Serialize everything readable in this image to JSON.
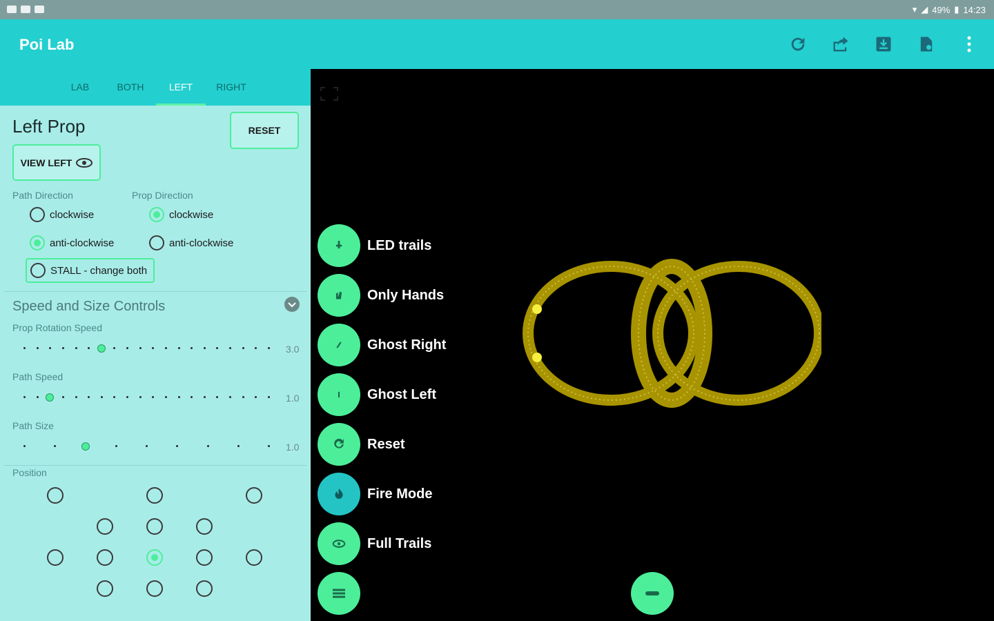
{
  "status": {
    "battery": "49%",
    "time": "14:23"
  },
  "app": {
    "title": "Poi Lab"
  },
  "tabs": [
    "LAB",
    "BOTH",
    "LEFT",
    "RIGHT"
  ],
  "panel": {
    "title": "Left Prop",
    "reset_label": "RESET",
    "view_left_label": "VIEW LEFT",
    "path_direction_label": "Path Direction",
    "prop_direction_label": "Prop Direction",
    "clockwise": "clockwise",
    "anti_clockwise": "anti-clockwise",
    "stall_label": "STALL - change both",
    "speed_section": "Speed and Size Controls",
    "prop_rotation_label": "Prop Rotation Speed",
    "prop_rotation_value": "3.0",
    "path_speed_label": "Path Speed",
    "path_speed_value": "1.0",
    "path_size_label": "Path Size",
    "path_size_value": "1.0",
    "position_label": "Position"
  },
  "fab_menu": [
    {
      "label": "LED trails",
      "icon": "led-icon"
    },
    {
      "label": "Only Hands",
      "icon": "hand-icon"
    },
    {
      "label": "Ghost Right",
      "icon": "ghost-right-icon"
    },
    {
      "label": "Ghost Left",
      "icon": "ghost-left-icon"
    },
    {
      "label": "Reset",
      "icon": "reset-icon"
    },
    {
      "label": "Fire Mode",
      "icon": "fire-icon"
    },
    {
      "label": "Full Trails",
      "icon": "eye-icon"
    }
  ],
  "colors": {
    "accent": "#4cee9a",
    "appbar": "#24cfcf",
    "panel": "#a8ece8",
    "trail": "#b8a000"
  }
}
